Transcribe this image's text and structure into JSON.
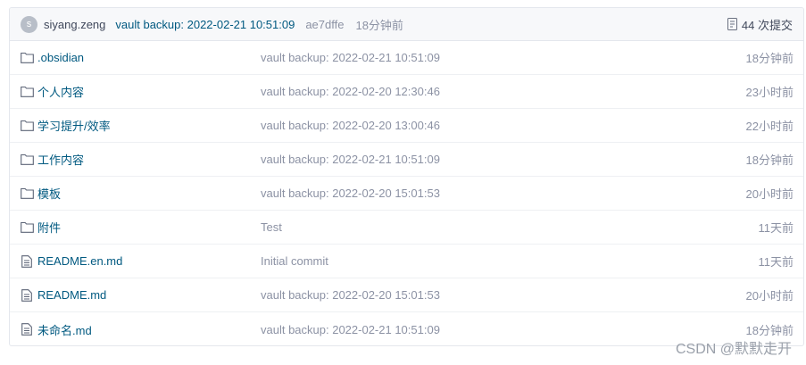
{
  "commit": {
    "avatar_letter": "s",
    "author": "siyang.zeng",
    "message": "vault backup: 2022-02-21 10:51:09",
    "sha": "ae7dffe",
    "time": "18分钟前",
    "count": "44 次提交"
  },
  "files": [
    {
      "name": ".obsidian",
      "type": "folder",
      "message": "vault backup: 2022-02-21 10:51:09",
      "time": "18分钟前"
    },
    {
      "name": "个人内容",
      "type": "folder",
      "message": "vault backup: 2022-02-20 12:30:46",
      "time": "23小时前"
    },
    {
      "name": "学习提升/效率",
      "type": "folder",
      "message": "vault backup: 2022-02-20 13:00:46",
      "time": "22小时前"
    },
    {
      "name": "工作内容",
      "type": "folder",
      "message": "vault backup: 2022-02-21 10:51:09",
      "time": "18分钟前"
    },
    {
      "name": "模板",
      "type": "folder",
      "message": "vault backup: 2022-02-20 15:01:53",
      "time": "20小时前"
    },
    {
      "name": "附件",
      "type": "folder",
      "message": "Test",
      "time": "11天前"
    },
    {
      "name": "README.en.md",
      "type": "file",
      "message": "Initial commit",
      "time": "11天前"
    },
    {
      "name": "README.md",
      "type": "file",
      "message": "vault backup: 2022-02-20 15:01:53",
      "time": "20小时前"
    },
    {
      "name": "未命名.md",
      "type": "file",
      "message": "vault backup: 2022-02-21 10:51:09",
      "time": "18分钟前"
    }
  ],
  "watermark": "CSDN @默默走开",
  "colors": {
    "link": "#005980",
    "muted": "#8c92a4",
    "header_bg": "#f7f8fa"
  }
}
